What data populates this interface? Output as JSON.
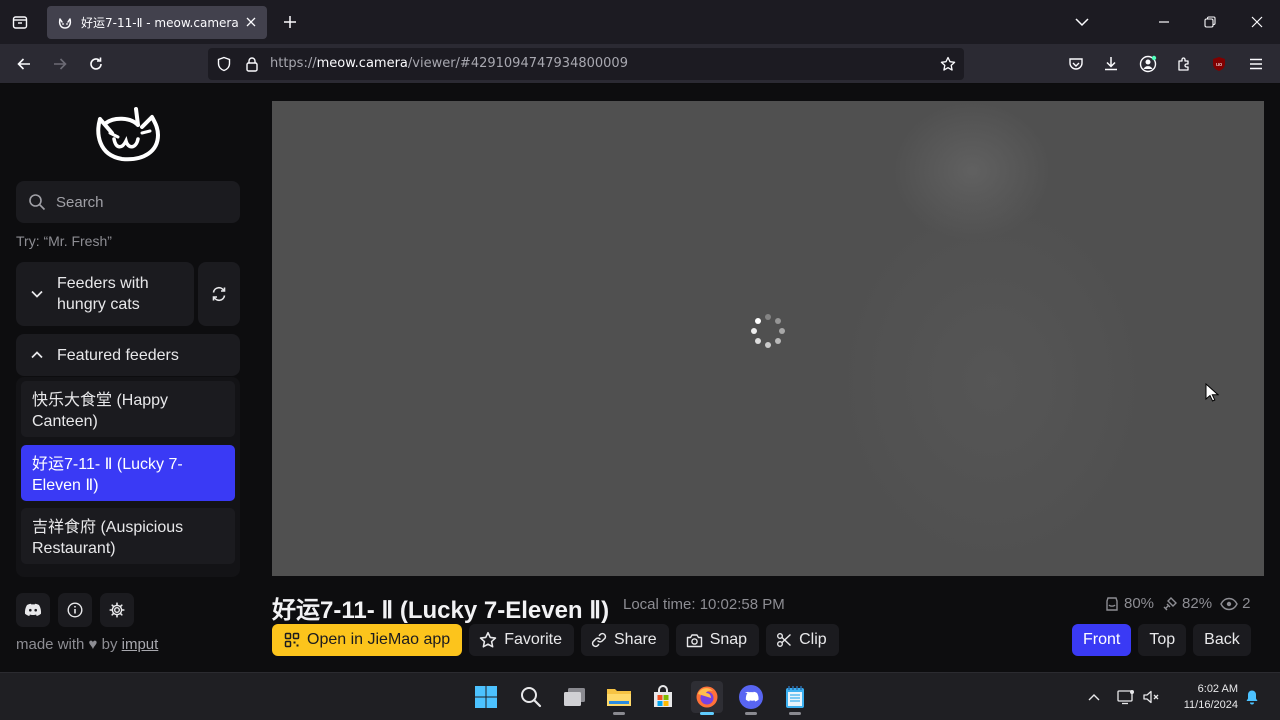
{
  "browser": {
    "tab_title": "好运7-11-Ⅱ - meow.camera",
    "url_prefix": "https://",
    "url_host": "meow.camera",
    "url_path": "/viewer/#4291094747934800009"
  },
  "sidebar": {
    "search_placeholder": "Search",
    "try_hint": "Try: “Mr. Fresh”",
    "section_hungry": "Feeders with hungry cats",
    "section_featured": "Featured feeders",
    "feeders": [
      {
        "label": "快乐大食堂 (Happy Canteen)",
        "active": false
      },
      {
        "label": "好运7-11- Ⅱ (Lucky 7-Eleven Ⅱ)",
        "active": true
      },
      {
        "label": "吉祥食府 (Auspicious Restaurant)",
        "active": false
      }
    ],
    "made_with": "made with",
    "by": "by",
    "author": "imput"
  },
  "feed": {
    "title": "好运7-11- Ⅱ (Lucky 7-Eleven Ⅱ)",
    "local_time": "Local time: 10:02:58 PM",
    "food_level": "80%",
    "battery_level": "82%",
    "viewers": "2"
  },
  "actions": {
    "open_app": "Open in JieMao app",
    "favorite": "Favorite",
    "share": "Share",
    "snap": "Snap",
    "clip": "Clip"
  },
  "views": {
    "front": "Front",
    "top": "Top",
    "back": "Back",
    "selected": "Front"
  },
  "taskbar": {
    "time": "6:02 AM",
    "date": "11/16/2024"
  },
  "colors": {
    "accent": "#3a3af5",
    "primary_button": "#fcc41c",
    "background": "#0d0d0f",
    "panel": "#1b1b1f"
  }
}
